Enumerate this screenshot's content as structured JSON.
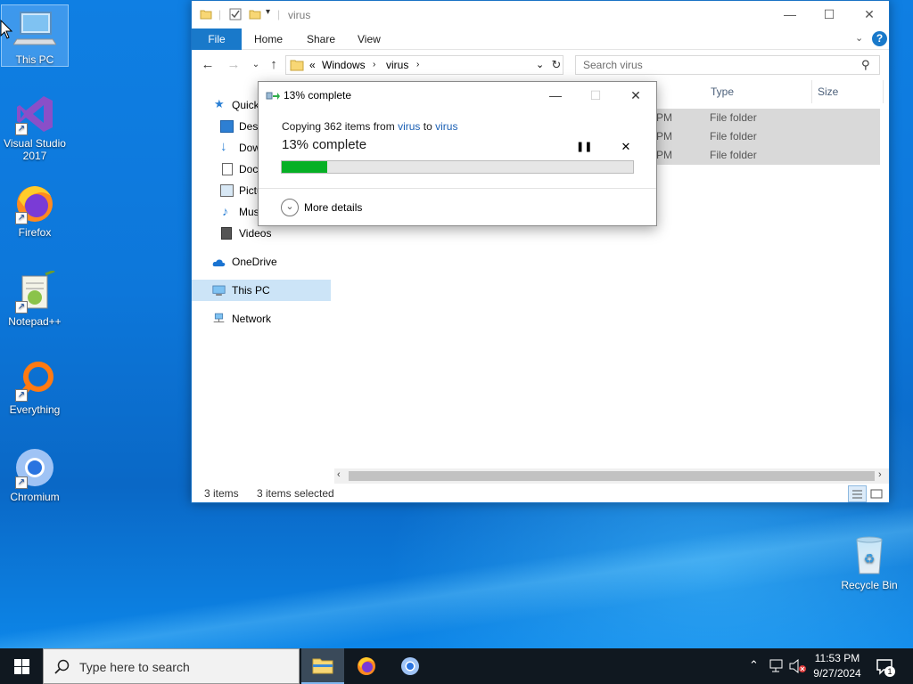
{
  "desktop": {
    "icons": [
      {
        "label": "This PC"
      },
      {
        "label": "Visual Studio 2017"
      },
      {
        "label": "Firefox"
      },
      {
        "label": "Notepad++"
      },
      {
        "label": "Everything"
      },
      {
        "label": "Chromium"
      },
      {
        "label": "Recycle Bin"
      }
    ]
  },
  "explorer": {
    "title": "virus",
    "tabs": [
      "File",
      "Home",
      "Share",
      "View"
    ],
    "address": {
      "overflow": "«",
      "segments": [
        "Windows",
        "virus"
      ]
    },
    "search_placeholder": "Search virus",
    "nav": {
      "quick_access": "Quick access",
      "desktop": "Desktop",
      "downloads": "Downloads",
      "documents": "Documents",
      "pictures": "Pictures",
      "music": "Music",
      "videos": "Videos",
      "onedrive": "OneDrive",
      "this_pc": "This PC",
      "network": "Network"
    },
    "columns": {
      "type": "Type",
      "size": "Size"
    },
    "rows": [
      {
        "time_suffix": "PM",
        "type": "File folder"
      },
      {
        "time_suffix": "PM",
        "type": "File folder"
      },
      {
        "time_suffix": "PM",
        "type": "File folder"
      }
    ],
    "status": {
      "items": "3 items",
      "selected": "3 items selected"
    }
  },
  "copy_dialog": {
    "title": "13% complete",
    "line_prefix": "Copying 362 items from",
    "from": "virus",
    "to_word": "to",
    "to": "virus",
    "percent_text": "13% complete",
    "progress": 0.13,
    "more_details": "More details"
  },
  "taskbar": {
    "search_placeholder": "Type here to search",
    "time": "11:53 PM",
    "date": "9/27/2024",
    "notification_count": "1"
  },
  "colors": {
    "accent": "#1979ca",
    "progress": "#06b025",
    "selection": "#cce4f7"
  }
}
